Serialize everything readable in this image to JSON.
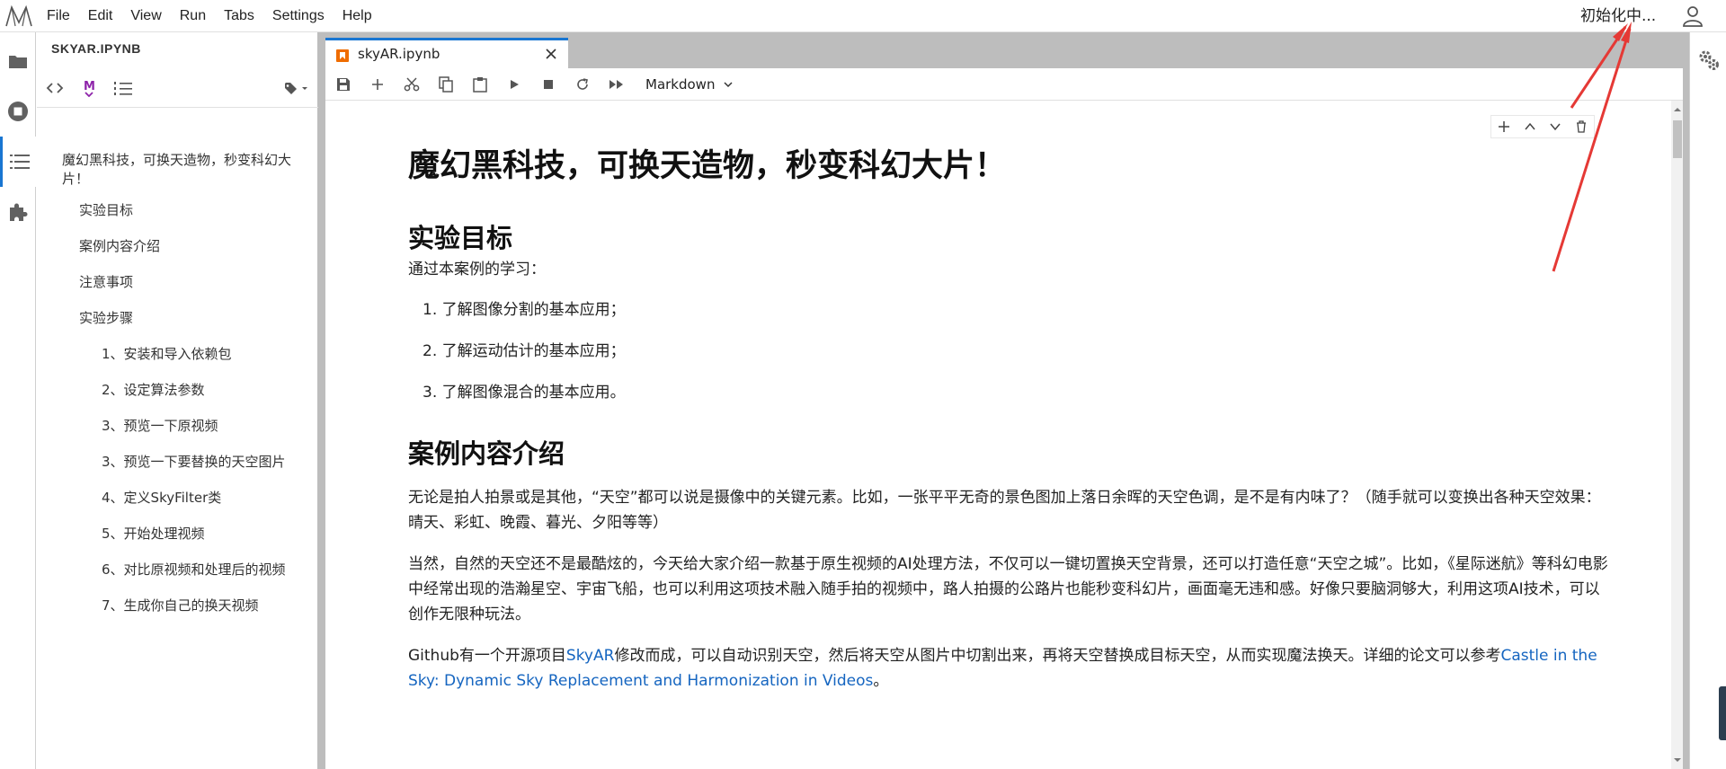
{
  "menu": [
    "File",
    "Edit",
    "View",
    "Run",
    "Tabs",
    "Settings",
    "Help"
  ],
  "kernel_status": "初始化中...",
  "icons": {
    "logo": "modelarts-logo",
    "user": "user-icon",
    "activity": [
      "folder-icon",
      "stop-circle-icon",
      "list-icon",
      "puzzle-icon"
    ],
    "property_inspector": "gear-icon"
  },
  "toc": {
    "title": "SKYAR.IPYNB",
    "entries": [
      {
        "text": "魔幻黑科技，可换天造物，秒变科幻大片！",
        "level": 1
      },
      {
        "text": "实验目标",
        "level": 2
      },
      {
        "text": "案例内容介绍",
        "level": 2
      },
      {
        "text": "注意事项",
        "level": 2
      },
      {
        "text": "实验步骤",
        "level": 2
      },
      {
        "text": "1、安装和导入依赖包",
        "level": 3
      },
      {
        "text": "2、设定算法参数",
        "level": 3
      },
      {
        "text": "3、预览一下原视频",
        "level": 3
      },
      {
        "text": "3、预览一下要替换的天空图片",
        "level": 3
      },
      {
        "text": "4、定义SkyFilter类",
        "level": 3
      },
      {
        "text": "5、开始处理视频",
        "level": 3
      },
      {
        "text": "6、对比原视频和处理后的视频",
        "level": 3
      },
      {
        "text": "7、生成你自己的换天视频",
        "level": 3
      }
    ]
  },
  "tab": {
    "label": "skyAR.ipynb"
  },
  "notebook_toolbar": {
    "cell_type": "Markdown"
  },
  "doc": {
    "title": "魔幻黑科技，可换天造物，秒变科幻大片！",
    "section1": "实验目标",
    "intro": "通过本案例的学习：",
    "list": [
      "1. 了解图像分割的基本应用；",
      "2. 了解运动估计的基本应用；",
      "3. 了解图像混合的基本应用。"
    ],
    "section2": "案例内容介绍",
    "para1": "无论是拍人拍景或是其他，“天空”都可以说是摄像中的关键元素。比如，一张平平无奇的景色图加上落日余晖的天空色调，是不是有内味了？（随手就可以变换出各种天空效果：晴天、彩虹、晚霞、暮光、夕阳等等）",
    "para2": "当然，自然的天空还不是最酷炫的，今天给大家介绍一款基于原生视频的AI处理方法，不仅可以一键切置换天空背景，还可以打造任意“天空之城”。比如，《星际迷航》等科幻电影中经常出现的浩瀚星空、宇宙飞船，也可以利用这项技术融入随手拍的视频中，路人拍摄的公路片也能秒变科幻片，画面毫无违和感。好像只要脑洞够大，利用这项AI技术，可以创作无限种玩法。",
    "para3_a": "Github有一个开源项目",
    "para3_link1": "SkyAR",
    "para3_b": "修改而成，可以自动识别天空，然后将天空从图片中切割出来，再将天空替换成目标天空，从而实现魔法换天。详细的论文可以参考",
    "para3_link2": "Castle in the Sky: Dynamic Sky Replacement and Harmonization in Videos",
    "para3_c": "。"
  },
  "colors": {
    "accent": "#1976d2",
    "link": "#1565c0",
    "annotation": "#e53935"
  }
}
